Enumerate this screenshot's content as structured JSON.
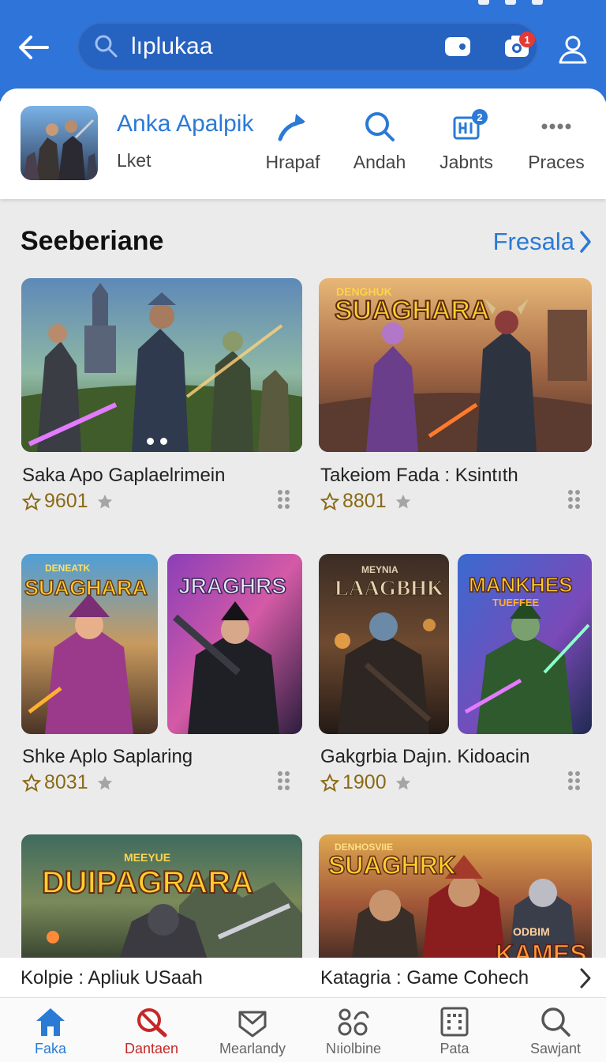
{
  "search": {
    "query": "lıplukaa",
    "camera_badge": "1"
  },
  "app": {
    "name": "Anka Apalpik",
    "subtitle": "Lket"
  },
  "quick_actions": [
    {
      "label": "Hrapaf",
      "icon": "share-arrow-icon"
    },
    {
      "label": "Andah",
      "icon": "search-icon"
    },
    {
      "label": "Jabnts",
      "icon": "grid-icon",
      "badge": "2"
    },
    {
      "label": "Praces",
      "icon": "more-icon"
    }
  ],
  "section": {
    "title": "Seeberiane",
    "link": "Fresala"
  },
  "games": [
    {
      "title": "Saka Apo Gaplaelrimein",
      "rating": "9601"
    },
    {
      "title": "Takeiom Fada : Ksintıth",
      "rating": "8801"
    },
    {
      "title": "Shke Aplo Saplaring",
      "rating": "8031"
    },
    {
      "title": "Gakgrbia Dajın. Kidoacin",
      "rating": "1900"
    }
  ],
  "poster_text": {
    "p2_top": "DENGHUK",
    "p2_main": "SUAGHARA",
    "p3_top": "DENEATK",
    "p3_main": "SUAGHARA",
    "p4_main": "JRAGHRS",
    "p5_top": "MEYNIA",
    "p5_main": "LAAGBHK",
    "p6_main": "MANKHES",
    "p6_sub": "TUEFFEE",
    "p7_top": "MEEYUE",
    "p7_main": "DUIPAGRARA",
    "p8_top": "DENHOSVIIE",
    "p8_main": "SUAGHRK",
    "p8_sub": "ODBIM",
    "p8_bottom": "KAMES"
  },
  "bottom_strip": {
    "left": "Kolpie : Apliuk USaah",
    "right": "Katagria : Game Cohech"
  },
  "nav": [
    {
      "label": "Faka",
      "icon": "home-icon"
    },
    {
      "label": "Dantaen",
      "icon": "blocked-search-icon"
    },
    {
      "label": "Mearlandy",
      "icon": "mail-shield-icon"
    },
    {
      "label": "Nıiolbine",
      "icon": "apps-icon"
    },
    {
      "label": "Pata",
      "icon": "dialpad-icon"
    },
    {
      "label": "Sawjant",
      "icon": "search-icon"
    }
  ],
  "colors": {
    "primary": "#2f74d8",
    "accent": "#2a7ad6",
    "badge_red": "#e53935",
    "rating_gold": "#8a6a16"
  }
}
